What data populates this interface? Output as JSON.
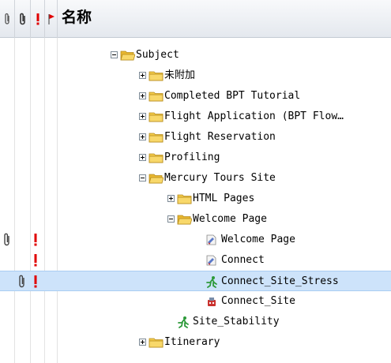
{
  "header": {
    "title": "名称",
    "columns": [
      "attachment-icon",
      "attachment-icon",
      "priority-icon",
      "flag-icon"
    ]
  },
  "tree": [
    {
      "label": "Subject",
      "type": "folder",
      "expanded": true,
      "level": 0
    },
    {
      "label": "未附加",
      "type": "folder",
      "expanded": false,
      "level": 1
    },
    {
      "label": "Completed BPT Tutorial",
      "type": "folder",
      "expanded": false,
      "level": 1
    },
    {
      "label": "Flight Application (BPT Flow…",
      "type": "folder",
      "expanded": false,
      "level": 1
    },
    {
      "label": "Flight Reservation",
      "type": "folder",
      "expanded": false,
      "level": 1
    },
    {
      "label": "Profiling",
      "type": "folder",
      "expanded": false,
      "level": 1
    },
    {
      "label": "Mercury Tours Site",
      "type": "folder",
      "expanded": true,
      "level": 1
    },
    {
      "label": "HTML Pages",
      "type": "folder",
      "expanded": false,
      "level": 2
    },
    {
      "label": "Welcome Page",
      "type": "folder",
      "expanded": true,
      "level": 2
    },
    {
      "label": "Welcome Page",
      "type": "manual-test-icon",
      "level": 3,
      "attachment": true,
      "priority": true
    },
    {
      "label": "Connect",
      "type": "manual-test-icon",
      "level": 3,
      "priority": true
    },
    {
      "label": "Connect_Site_Stress",
      "type": "load-test-icon",
      "level": 3,
      "attachment": true,
      "priority": true,
      "selected": true
    },
    {
      "label": "Connect_Site",
      "type": "business-process-icon",
      "level": 3
    },
    {
      "label": "Site_Stability",
      "type": "load-test-icon",
      "level": 2
    },
    {
      "label": "Itinerary",
      "type": "folder",
      "expanded": false,
      "level": 1
    }
  ],
  "colors": {
    "selection": "#cde3fa",
    "priority": "#e00000",
    "folder": "#f4cb4a"
  }
}
